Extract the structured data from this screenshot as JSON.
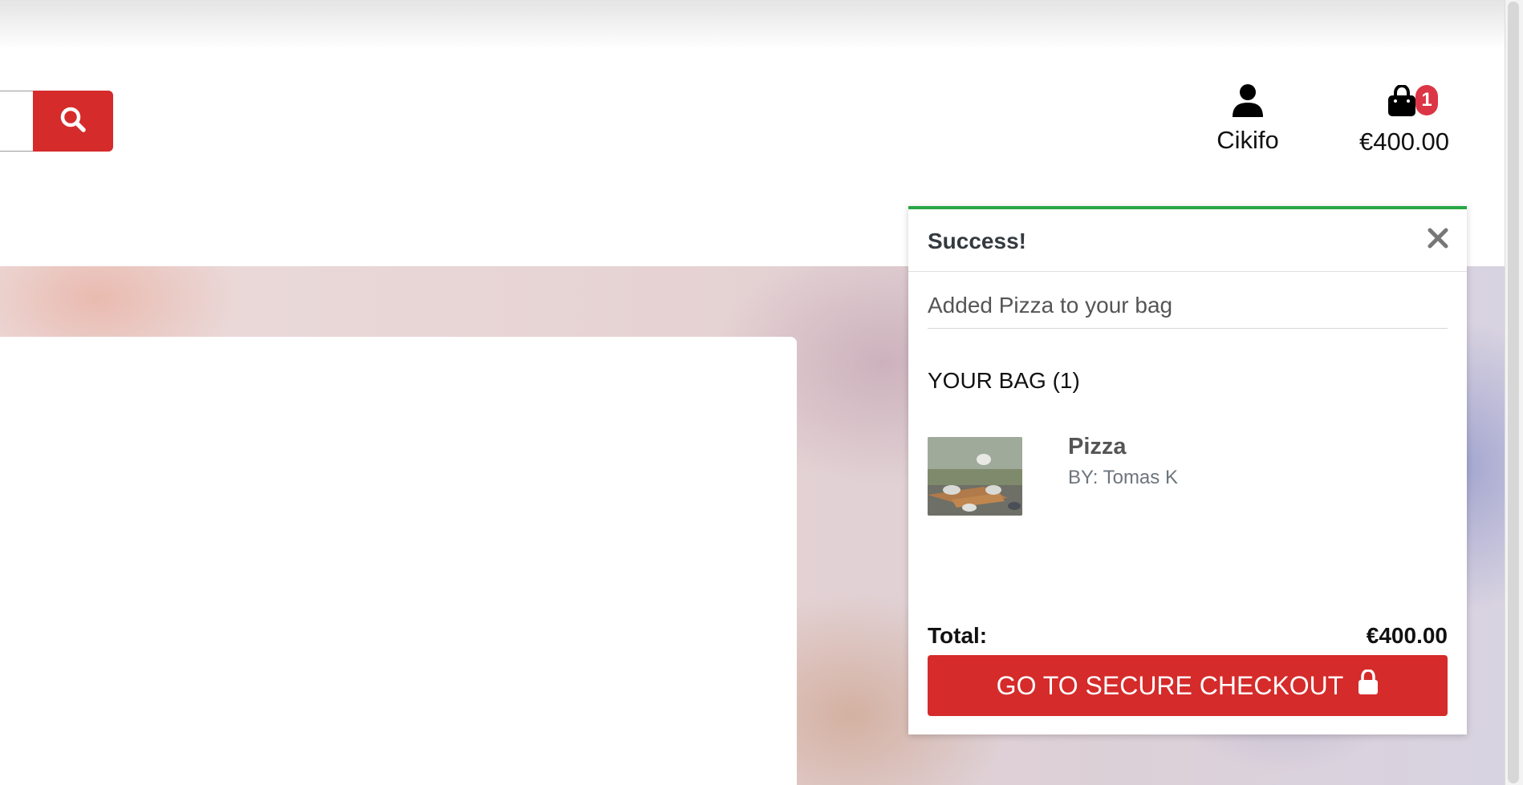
{
  "header": {
    "account": {
      "label": "Cikifo",
      "icon": "user-icon"
    },
    "bag": {
      "count": "1",
      "total": "€400.00",
      "icon": "shopping-bag-icon"
    },
    "search": {
      "icon": "search-icon"
    }
  },
  "toast": {
    "title": "Success!",
    "message": "Added Pizza to your bag",
    "bag_heading": "YOUR BAG (1)",
    "item": {
      "name": "Pizza",
      "artist": "BY: Tomas K"
    },
    "total_label": "Total:",
    "total_value": "€400.00",
    "checkout_label": "GO TO SECURE CHECKOUT",
    "close_icon": "close-icon",
    "lock_icon": "lock-icon"
  },
  "colors": {
    "accent_red": "#d52b2b",
    "badge_red": "#dc3545",
    "success_green": "#28a745"
  }
}
